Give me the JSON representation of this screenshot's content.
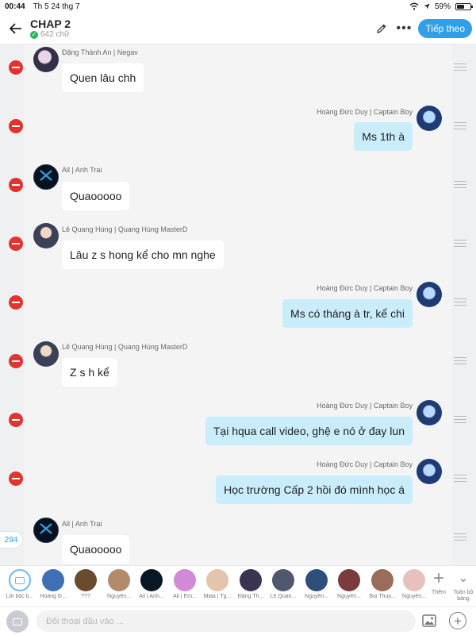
{
  "status_bar": {
    "time": "00:44",
    "date": "Th 5 24 thg 7",
    "battery": "59%",
    "battery_level": 0.59
  },
  "header": {
    "title": "CHAP 2",
    "subtitle": "642 chữ",
    "follow_label": "Tiếp theo"
  },
  "messages": [
    {
      "author": "Đặng Thành An | Negav",
      "text": "Quen lâu chh",
      "side": "in",
      "avatar": "dang"
    },
    {
      "author": "Hoàng Đức Duy | Captain Boy",
      "text": "Ms 1th à",
      "side": "out",
      "avatar": "duy"
    },
    {
      "author": "All | Anh Trai",
      "text": "Quaooooo",
      "side": "in",
      "avatar": "all"
    },
    {
      "author": "Lê Quang Hùng | Quang Hùng MasterD",
      "text": "Lâu z s hong kể cho mn nghe",
      "side": "in",
      "avatar": "hung"
    },
    {
      "author": "Hoàng Đức Duy | Captain Boy",
      "text": "Ms có tháng à tr, kể chi",
      "side": "out",
      "avatar": "duy"
    },
    {
      "author": "Lê Quang Hùng | Quang Hùng MasterD",
      "text": "Z s h kể",
      "side": "in",
      "avatar": "hung"
    },
    {
      "author": "Hoàng Đức Duy | Captain Boy",
      "text": "Tại hqua call video, ghệ e nó ở đay lun",
      "side": "out",
      "avatar": "duy"
    },
    {
      "author": "Hoàng Đức Duy | Captain Boy",
      "text": "Học trường Cấp 2 hồi đó mình học á",
      "side": "out",
      "avatar": "duy"
    },
    {
      "author": "All | Anh Trai",
      "text": "Quaooooo",
      "side": "in",
      "avatar": "all"
    }
  ],
  "unread_count": "294",
  "characters": [
    {
      "label": "Lời bộc b...",
      "color": "#ffffff"
    },
    {
      "label": "Hoàng Đ...",
      "color": "#3f6fb5"
    },
    {
      "label": "???",
      "color": "#6b4b2f"
    },
    {
      "label": "Nguyễn...",
      "color": "#b48a6c"
    },
    {
      "label": "All | Anh...",
      "color": "#0b1624"
    },
    {
      "label": "All | Em...",
      "color": "#d08ad6"
    },
    {
      "label": "Miaa | Tg...",
      "color": "#e3c4ad"
    },
    {
      "label": "Đặng Th...",
      "color": "#3a3450"
    },
    {
      "label": "Lê Quan...",
      "color": "#50586e"
    },
    {
      "label": "Nguyễn...",
      "color": "#2d4f7a"
    },
    {
      "label": "Nguyễn...",
      "color": "#7a3b3b"
    },
    {
      "label": "Bùi Thuỳ...",
      "color": "#9a6c5a"
    },
    {
      "label": "Nguyễn...",
      "color": "#e7c2bc"
    }
  ],
  "strip_actions": {
    "add_label": "Thêm",
    "expand_label": "Toàn bộ bảng"
  },
  "composer": {
    "placeholder": "Đối thoại đầu vào ..."
  },
  "colors": {
    "accent": "#2f9fe8",
    "delete": "#e2342e",
    "outgoing_bubble": "#c9edfb",
    "verified": "#2bb55c"
  }
}
